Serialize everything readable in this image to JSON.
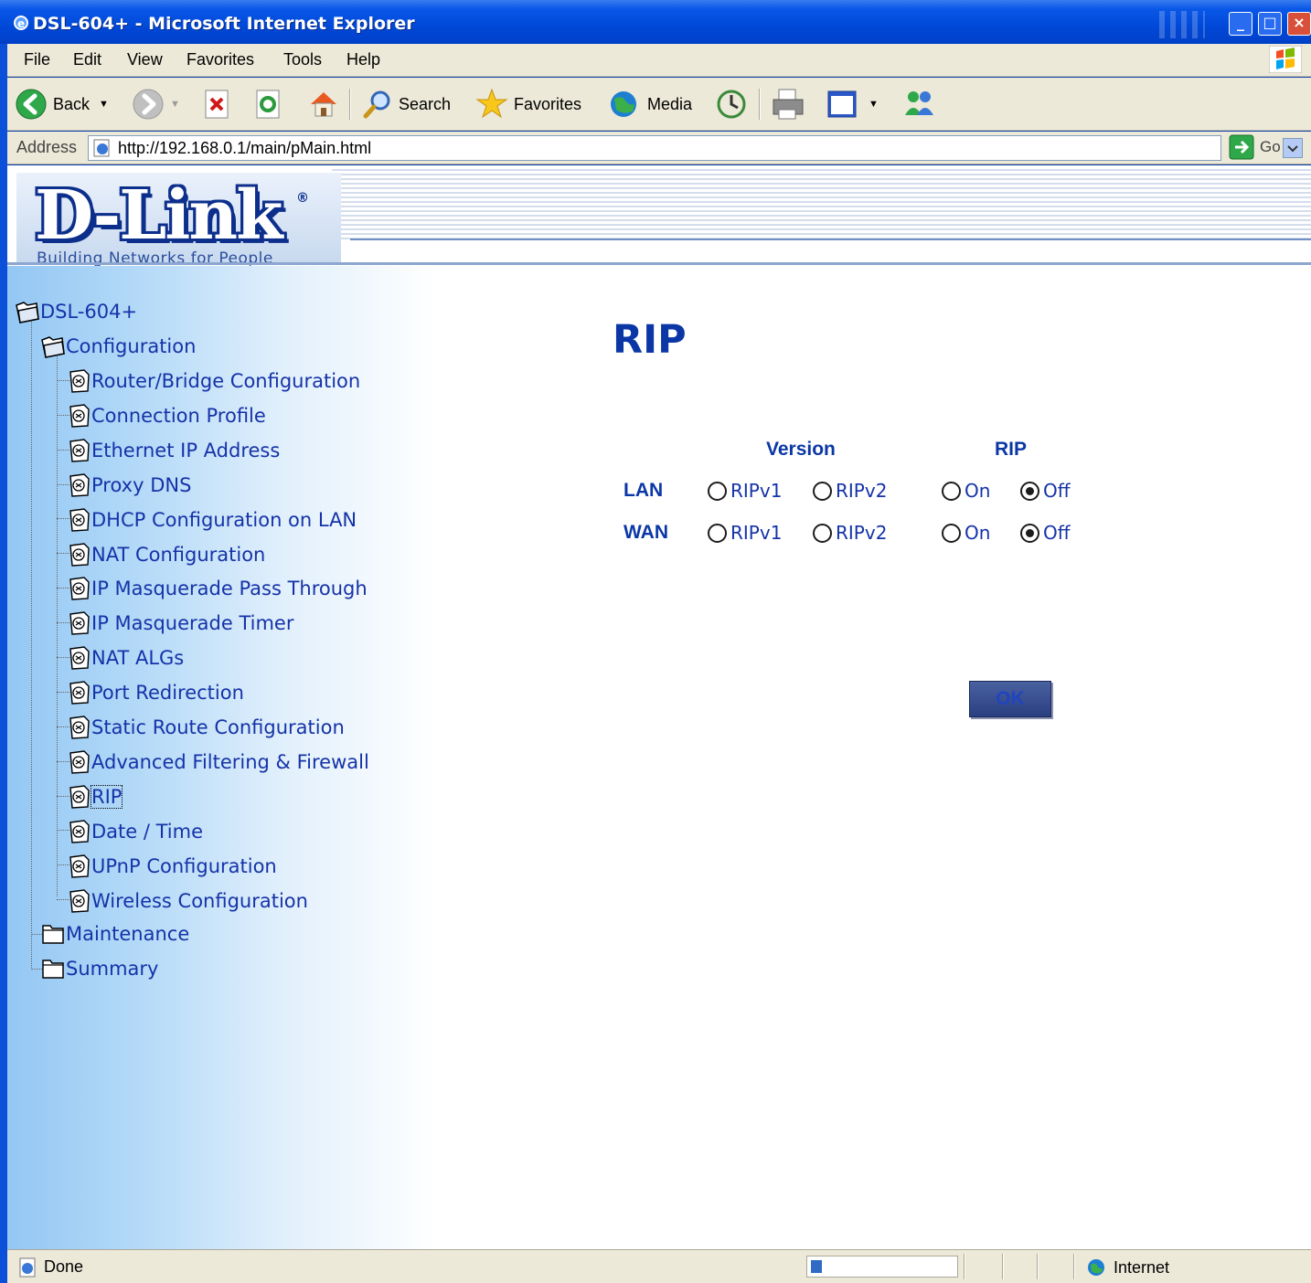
{
  "window": {
    "title": "DSL-604+ - Microsoft Internet Explorer",
    "buttons": [
      "minimize",
      "maximize",
      "close"
    ]
  },
  "menubar": {
    "items": [
      "File",
      "Edit",
      "View",
      "Favorites",
      "Tools",
      "Help"
    ]
  },
  "toolbar": {
    "back_label": "Back",
    "search_label": "Search",
    "favorites_label": "Favorites",
    "media_label": "Media"
  },
  "addressbar": {
    "label": "Address",
    "url": "http://192.168.0.1/main/pMain.html",
    "go_label": "Go"
  },
  "banner": {
    "logo": "D-Link",
    "tagline": "Building Networks for People"
  },
  "tree": {
    "root": "DSL-604+",
    "configuration": "Configuration",
    "items": [
      "Router/Bridge Configuration",
      "Connection Profile",
      "Ethernet IP Address",
      "Proxy DNS",
      "DHCP Configuration on LAN",
      "NAT Configuration",
      "IP Masquerade Pass Through",
      "IP Masquerade Timer",
      "NAT ALGs",
      "Port Redirection",
      "Static Route Configuration",
      "Advanced Filtering & Firewall",
      "RIP",
      "Date / Time",
      "UPnP Configuration",
      "Wireless Configuration"
    ],
    "selected": "RIP",
    "maintenance": "Maintenance",
    "summary": "Summary"
  },
  "content": {
    "heading": "RIP",
    "col_version": "Version",
    "col_rip": "RIP",
    "rows": [
      {
        "label": "LAN",
        "v1": "RIPv1",
        "v2": "RIPv2",
        "on": "On",
        "off": "Off",
        "version_selected": null,
        "rip_selected": "Off"
      },
      {
        "label": "WAN",
        "v1": "RIPv1",
        "v2": "RIPv2",
        "on": "On",
        "off": "Off",
        "version_selected": null,
        "rip_selected": "Off"
      }
    ],
    "ok_label": "OK"
  },
  "statusbar": {
    "status": "Done",
    "zone": "Internet",
    "progress": 0.08
  },
  "colors": {
    "title_blue": "#0048d8",
    "link_blue": "#1533a8",
    "heading_blue": "#0b37a6",
    "chrome": "#ece9d8"
  }
}
